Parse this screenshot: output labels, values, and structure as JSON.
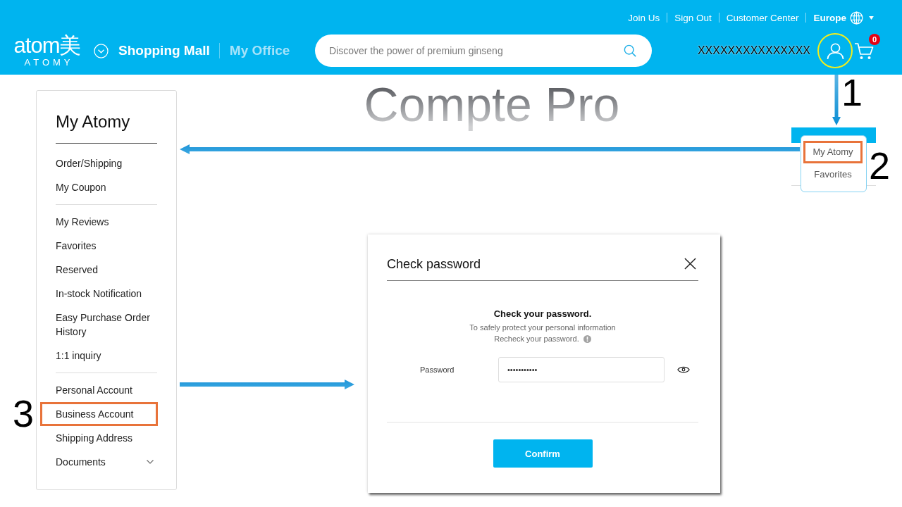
{
  "header": {
    "top_links": [
      {
        "label": "Join Us"
      },
      {
        "label": "Sign Out"
      },
      {
        "label": "Customer Center"
      }
    ],
    "region": {
      "label": "Europe"
    },
    "logo": {
      "wordmark": "atom美",
      "tagline": "ATOMY"
    },
    "nav": [
      {
        "label": "Shopping Mall",
        "selected": true
      },
      {
        "label": "My Office",
        "selected": false
      }
    ],
    "search": {
      "placeholder": "Discover the power of premium ginseng"
    },
    "user_name": "XXXXXXXXXXXXXXX",
    "account_button": {
      "highlighted": true,
      "step": "1"
    },
    "cart_count": "0"
  },
  "page_title": "Compte Pro",
  "user_menu": {
    "items": [
      {
        "label": "My Atomy",
        "highlighted": true,
        "step": "2"
      },
      {
        "label": "Favorites",
        "highlighted": false
      }
    ]
  },
  "sidebar": {
    "title": "My Atomy",
    "groups": [
      {
        "items": [
          {
            "label": "Order/Shipping",
            "kind": "link",
            "highlighted": false
          },
          {
            "label": "My Coupon",
            "kind": "link",
            "highlighted": false
          }
        ]
      },
      {
        "items": [
          {
            "label": "My Reviews",
            "kind": "link",
            "highlighted": false
          },
          {
            "label": "Favorites",
            "kind": "link",
            "highlighted": false
          },
          {
            "label": "Reserved",
            "kind": "link",
            "highlighted": false
          },
          {
            "label": "In-stock Notification",
            "kind": "link",
            "highlighted": false
          },
          {
            "label": "Easy Purchase Order History",
            "kind": "link",
            "highlighted": false
          },
          {
            "label": "1:1 inquiry",
            "kind": "link",
            "highlighted": false
          }
        ]
      },
      {
        "items": [
          {
            "label": "Personal Account",
            "kind": "link",
            "highlighted": false
          },
          {
            "label": "Business Account",
            "kind": "link",
            "highlighted": true,
            "step": "3"
          },
          {
            "label": "Shipping Address",
            "kind": "link",
            "highlighted": false
          },
          {
            "label": "Documents",
            "kind": "dropdown",
            "highlighted": false
          }
        ]
      }
    ]
  },
  "dialog": {
    "title": "Check password",
    "heading": "Check your password.",
    "message_lines": [
      "To safely protect your personal information",
      "Recheck your password."
    ],
    "field": {
      "label": "Password",
      "value": "•••••••••••"
    },
    "confirm_label": "Confirm"
  }
}
